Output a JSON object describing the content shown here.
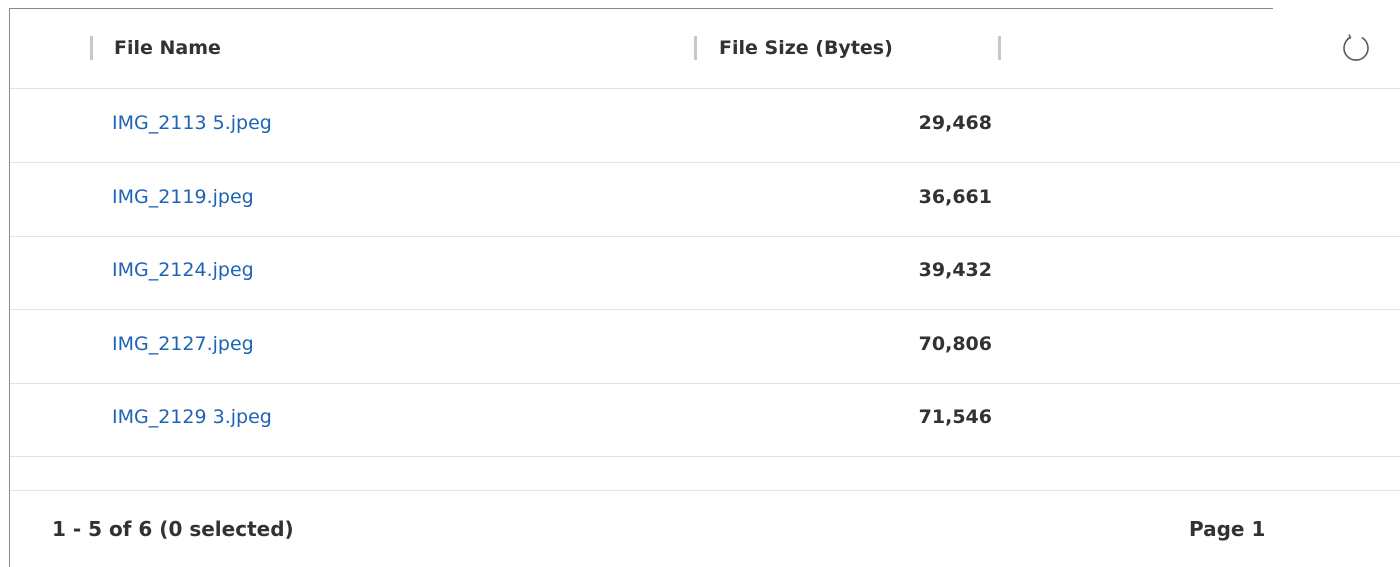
{
  "table": {
    "columns": [
      {
        "label": "File Name"
      },
      {
        "label": "File Size (Bytes)"
      }
    ],
    "rows": [
      {
        "file_name": "IMG_2113 5.jpeg",
        "file_size": "29,468"
      },
      {
        "file_name": "IMG_2119.jpeg",
        "file_size": "36,661"
      },
      {
        "file_name": "IMG_2124.jpeg",
        "file_size": "39,432"
      },
      {
        "file_name": "IMG_2127.jpeg",
        "file_size": "70,806"
      },
      {
        "file_name": "IMG_2129 3.jpeg",
        "file_size": "71,546"
      }
    ]
  },
  "footer": {
    "status": "1 - 5 of 6 (0 selected)",
    "page": "Page 1"
  },
  "icons": {
    "refresh": "refresh-icon"
  },
  "colors": {
    "link": "#1e63b5",
    "text": "#323232",
    "divider": "#e3e3e3"
  }
}
